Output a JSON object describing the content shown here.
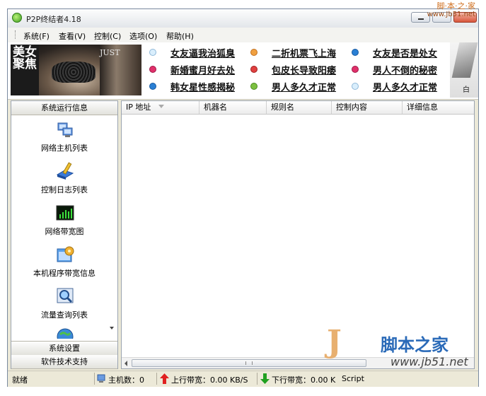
{
  "window": {
    "title": "P2P终结者4.18"
  },
  "watermark_top": {
    "line1": "脚·本·之·家",
    "line2": "www.Jb51.net"
  },
  "menu": {
    "items": [
      "系统(F)",
      "查看(V)",
      "控制(C)",
      "选项(O)",
      "帮助(H)"
    ]
  },
  "banner": {
    "ad_title_lines": [
      "美女",
      "聚焦"
    ],
    "ad_brand": "JUST",
    "links": [
      {
        "text": "女友逼我治狐臭",
        "dot": "#d9eefc"
      },
      {
        "text": "二折机票飞上海",
        "dot": "#f0a040"
      },
      {
        "text": "女友是否是处女",
        "dot": "#2a7fd4"
      },
      {
        "text": "新婚蜜月好去处",
        "dot": "#e0306a"
      },
      {
        "text": "包皮长导致阳痿",
        "dot": "#e04040"
      },
      {
        "text": "男人不倒的秘密",
        "dot": "#e0306a"
      },
      {
        "text": "韩女星性感揭秘",
        "dot": "#2a7fd4"
      },
      {
        "text": "男人多久才正常",
        "dot": "#7cc040"
      },
      {
        "text": "男人多久才正常",
        "dot": "#d9eefc"
      }
    ],
    "right_text": "白"
  },
  "sidebar": {
    "top_header": "系统运行信息",
    "items": [
      {
        "label": "网络主机列表",
        "icon": "network-hosts-icon"
      },
      {
        "label": "控制日志列表",
        "icon": "control-log-icon"
      },
      {
        "label": "网络带宽图",
        "icon": "bandwidth-graph-icon"
      },
      {
        "label": "本机程序带宽信息",
        "icon": "program-bandwidth-icon"
      },
      {
        "label": "流量查询列表",
        "icon": "traffic-query-icon"
      }
    ],
    "bottom_headers": [
      "系统设置",
      "软件技术支持"
    ]
  },
  "listview": {
    "columns": [
      "IP 地址",
      "机器名",
      "规则名",
      "控制内容",
      "详细信息"
    ]
  },
  "status": {
    "ready": "就绪",
    "hosts_label": "主机数：0",
    "upload_label": "上行带宽：0.00 KB/S",
    "download_label": "下行带宽：0.00 K",
    "script_label": "Script"
  },
  "watermark_bottom": {
    "logo": "J",
    "name": "脚本之家",
    "url": "www.jb51.net"
  }
}
